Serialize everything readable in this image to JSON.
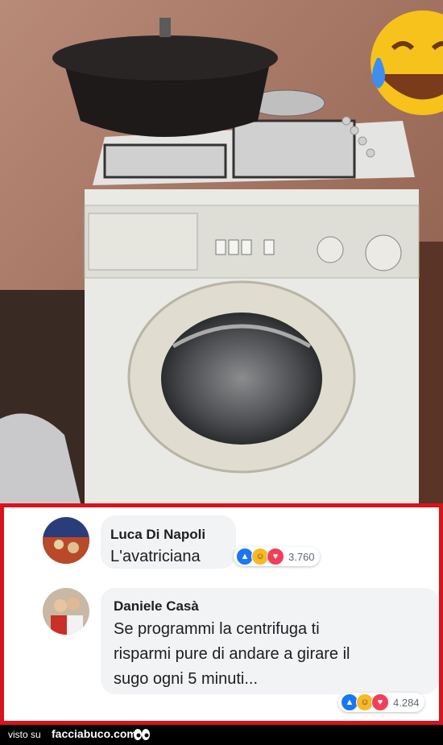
{
  "comments": [
    {
      "author": "Luca Di Napoli",
      "text_lines": [
        "L'avatriciana"
      ],
      "reaction_count": "3.760"
    },
    {
      "author": "Daniele Casà",
      "text_lines": [
        "Se programmi la centrifuga ti",
        "risparmi pure di andare a girare il",
        "sugo ogni 5 minuti..."
      ],
      "reaction_count": "4.284"
    }
  ],
  "footer": {
    "prefix": "visto su",
    "brand": "facciabuco.com"
  },
  "colors": {
    "frame": "#d9131b",
    "like": "#1877f2",
    "haha": "#f7b928",
    "love": "#f33e58"
  },
  "icons": [
    "laughing-emoji-icon",
    "like-icon",
    "haha-icon",
    "love-icon",
    "eyes-icon"
  ]
}
